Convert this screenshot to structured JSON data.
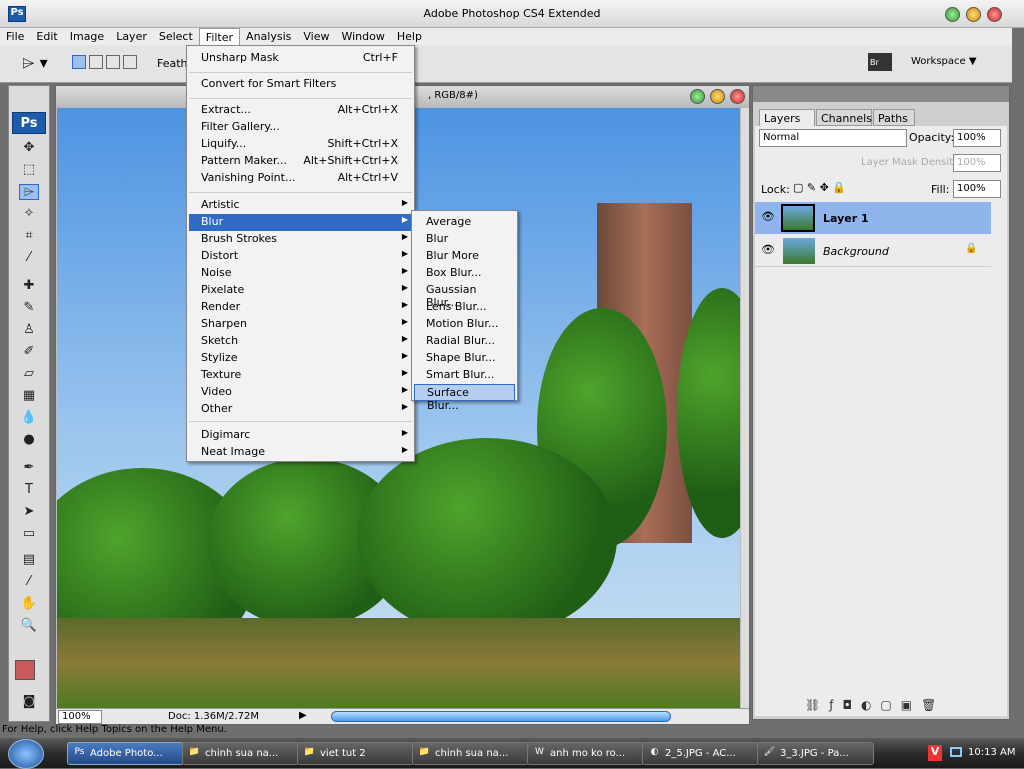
{
  "app": {
    "title": "Adobe Photoshop CS4 Extended",
    "logo": "Ps"
  },
  "menubar": [
    "File",
    "Edit",
    "Image",
    "Layer",
    "Select",
    "Filter",
    "Analysis",
    "View",
    "Window",
    "Help"
  ],
  "options": {
    "feather_label": "Feather:",
    "workspace_label": "Workspace"
  },
  "document": {
    "title_suffix": ", RGB/8#)",
    "zoom": "100%",
    "doc_info": "Doc: 1.36M/2.72M"
  },
  "filter_menu": {
    "top": [
      {
        "label": "Unsharp Mask",
        "shortcut": "Ctrl+F"
      },
      {
        "label": "Convert for Smart Filters",
        "shortcut": ""
      }
    ],
    "tools": [
      {
        "label": "Extract...",
        "shortcut": "Alt+Ctrl+X"
      },
      {
        "label": "Filter Gallery...",
        "shortcut": ""
      },
      {
        "label": "Liquify...",
        "shortcut": "Shift+Ctrl+X"
      },
      {
        "label": "Pattern Maker...",
        "shortcut": "Alt+Shift+Ctrl+X"
      },
      {
        "label": "Vanishing Point...",
        "shortcut": "Alt+Ctrl+V"
      }
    ],
    "groups": [
      "Artistic",
      "Blur",
      "Brush Strokes",
      "Distort",
      "Noise",
      "Pixelate",
      "Render",
      "Sharpen",
      "Sketch",
      "Stylize",
      "Texture",
      "Video",
      "Other"
    ],
    "plugins": [
      "Digimarc",
      "Neat Image"
    ],
    "active": "Blur"
  },
  "blur_submenu": {
    "items": [
      "Average",
      "Blur",
      "Blur More",
      "Box Blur...",
      "Gaussian Blur...",
      "Lens Blur...",
      "Motion Blur...",
      "Radial Blur...",
      "Shape Blur...",
      "Smart Blur...",
      "Surface Blur..."
    ],
    "highlighted": "Surface Blur..."
  },
  "layers_panel": {
    "tabs": [
      "Layers",
      "Channels",
      "Paths"
    ],
    "active_tab": "Layers",
    "blend_mode": "Normal",
    "opacity_label": "Opacity:",
    "opacity": "100%",
    "mask_density_label": "Layer Mask Density",
    "mask_density": "100%",
    "lock_label": "Lock:",
    "fill_label": "Fill:",
    "fill": "100%",
    "layers": [
      {
        "name": "Layer 1",
        "selected": true,
        "locked": false
      },
      {
        "name": "Background",
        "selected": false,
        "locked": true
      }
    ]
  },
  "help_text": "For Help, click Help Topics on the Help Menu.",
  "taskbar": {
    "items": [
      {
        "label": "Adobe Photo...",
        "icon": "Ps",
        "active": true
      },
      {
        "label": "chinh sua na...",
        "icon": "folder"
      },
      {
        "label": "viet tut 2",
        "icon": "folder"
      },
      {
        "label": "chinh sua na...",
        "icon": "folder"
      },
      {
        "label": "anh mo ko ro...",
        "icon": "word"
      },
      {
        "label": "2_5.JPG - AC...",
        "icon": "acdsee"
      },
      {
        "label": "3_3.JPG - Pa...",
        "icon": "paint"
      }
    ],
    "clock": "10:13 AM"
  },
  "colors": {
    "highlight": "#316ac5",
    "layer_selected": "#8fb5ec",
    "foreground": "#c85a5a"
  }
}
